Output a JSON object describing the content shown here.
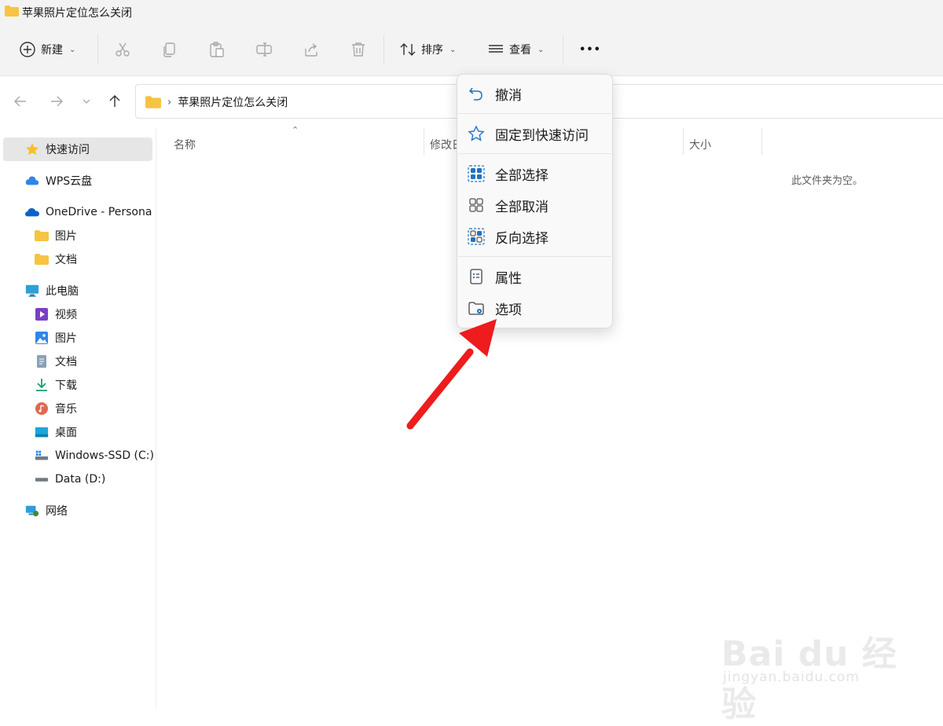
{
  "window": {
    "title": "苹果照片定位怎么关闭"
  },
  "toolbar": {
    "new_label": "新建",
    "sort_label": "排序",
    "view_label": "查看",
    "more_label": "•••"
  },
  "address": {
    "path": [
      "苹果照片定位怎么关闭"
    ]
  },
  "sidebar": {
    "items": [
      {
        "label": "快速访问",
        "icon": "star-icon"
      },
      {
        "label": "WPS云盘",
        "icon": "cloud-icon"
      },
      {
        "label": "OneDrive - Persona",
        "icon": "onedrive-icon"
      },
      {
        "label": "图片",
        "icon": "folder-icon"
      },
      {
        "label": "文档",
        "icon": "folder-icon"
      },
      {
        "label": "此电脑",
        "icon": "computer-icon"
      },
      {
        "label": "视频",
        "icon": "video-icon"
      },
      {
        "label": "图片",
        "icon": "pictures-icon"
      },
      {
        "label": "文档",
        "icon": "documents-icon"
      },
      {
        "label": "下载",
        "icon": "download-icon"
      },
      {
        "label": "音乐",
        "icon": "music-icon"
      },
      {
        "label": "桌面",
        "icon": "desktop-icon"
      },
      {
        "label": "Windows-SSD (C:)",
        "icon": "drive-icon"
      },
      {
        "label": "Data (D:)",
        "icon": "drive-icon"
      },
      {
        "label": "网络",
        "icon": "network-icon"
      }
    ]
  },
  "columns": {
    "name": "名称",
    "modified": "修改日",
    "size": "大小"
  },
  "empty_text": "此文件夹为空。",
  "menu": {
    "items": [
      {
        "label": "撤消",
        "icon": "undo-icon"
      },
      {
        "label": "固定到快速访问",
        "icon": "pin-star-icon"
      },
      {
        "label": "全部选择",
        "icon": "select-all-icon"
      },
      {
        "label": "全部取消",
        "icon": "select-none-icon"
      },
      {
        "label": "反向选择",
        "icon": "invert-selection-icon"
      },
      {
        "label": "属性",
        "icon": "properties-icon"
      },
      {
        "label": "选项",
        "icon": "folder-options-icon"
      }
    ]
  },
  "watermark": {
    "brand": "Bai du 经验",
    "url": "jingyan.baidu.com"
  },
  "colors": {
    "accent": "#0067c0",
    "arrow": "#ee1c1c",
    "folder": "#f6c343"
  }
}
